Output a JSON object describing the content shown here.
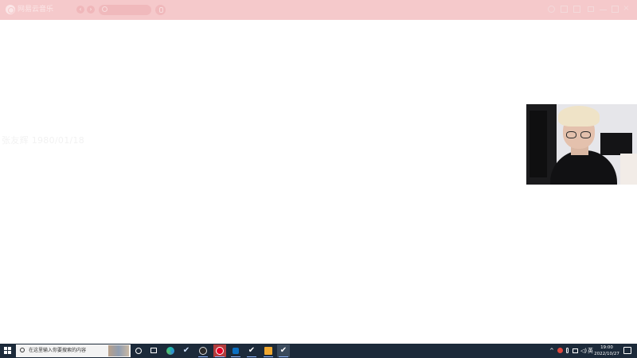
{
  "app": {
    "title": "网易云音乐",
    "search_placeholder": "",
    "accent_color": "#f5c9cb",
    "nav": {
      "back_icon": "chevron-left-icon",
      "forward_icon": "chevron-right-icon"
    },
    "window_controls": [
      "settings-icon",
      "skin-icon",
      "mail-icon",
      "mini-mode-icon",
      "minimize-icon",
      "maximize-icon",
      "close-icon"
    ]
  },
  "main": {
    "ghost_text": "张友辉 1980/01/18"
  },
  "taskbar": {
    "search_placeholder": "在这里输入你要搜索的内容",
    "apps": [
      "task-view-icon",
      "widgets-icon",
      "edge-icon",
      "steam-icon",
      "obs-icon",
      "netease-music-icon",
      "app-blue-icon",
      "steam-2-icon",
      "folder-icon",
      "steam-3-icon"
    ],
    "tray": {
      "language": "英",
      "time": "19:00",
      "date": "2022/10/27"
    }
  }
}
